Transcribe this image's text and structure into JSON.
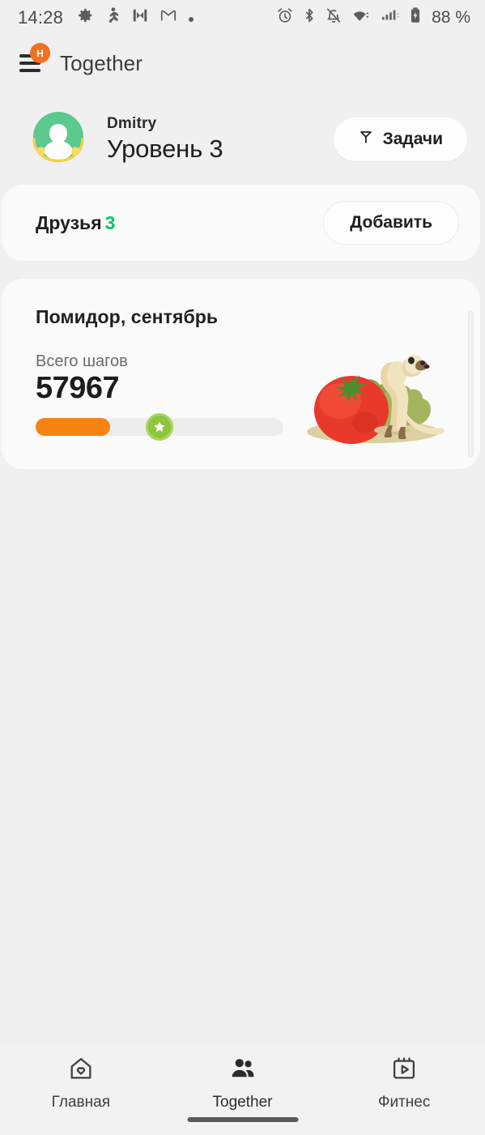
{
  "status_bar": {
    "time": "14:28",
    "battery_text": "88 %",
    "left_icons": [
      "settings-gear-icon",
      "person-activity-icon",
      "bowtie-app-icon",
      "gmail-icon",
      "more-dot-icon"
    ],
    "right_icons": [
      "alarm-clock-icon",
      "bluetooth-icon",
      "notifications-muted-icon",
      "wifi-icon",
      "cellular-signal-icon",
      "battery-icon"
    ]
  },
  "app_bar": {
    "menu_icon": "hamburger-menu-icon",
    "menu_badge": "H",
    "title": "Together"
  },
  "profile": {
    "avatar_icon": "avatar-laurel-icon",
    "name": "Dmitry",
    "level": "Уровень 3",
    "tasks_button": {
      "label": "Задачи",
      "icon": "flag-icon"
    }
  },
  "friends_card": {
    "label": "Друзья",
    "count": "3",
    "add_button_label": "Добавить"
  },
  "challenge_card": {
    "title": "Помидор, сентябрь",
    "steps_label": "Всего шагов",
    "steps_value": "57967",
    "progress_percent": 30,
    "star_marker_percent": 50,
    "illustration": "tomato-meerkat-illustration"
  },
  "bottom_nav": {
    "items": [
      {
        "label": "Главная",
        "icon": "home-heart-icon",
        "active": false
      },
      {
        "label": "Together",
        "icon": "people-icon",
        "active": true
      },
      {
        "label": "Фитнес",
        "icon": "calendar-play-icon",
        "active": false
      }
    ]
  },
  "colors": {
    "accent_orange": "#f37021",
    "progress_orange": "#f58410",
    "green_count": "#00c566",
    "avatar_green": "#5cc98f",
    "badge_green": "#8cc63e",
    "background": "#f0f0f0",
    "card": "#fafafa"
  }
}
